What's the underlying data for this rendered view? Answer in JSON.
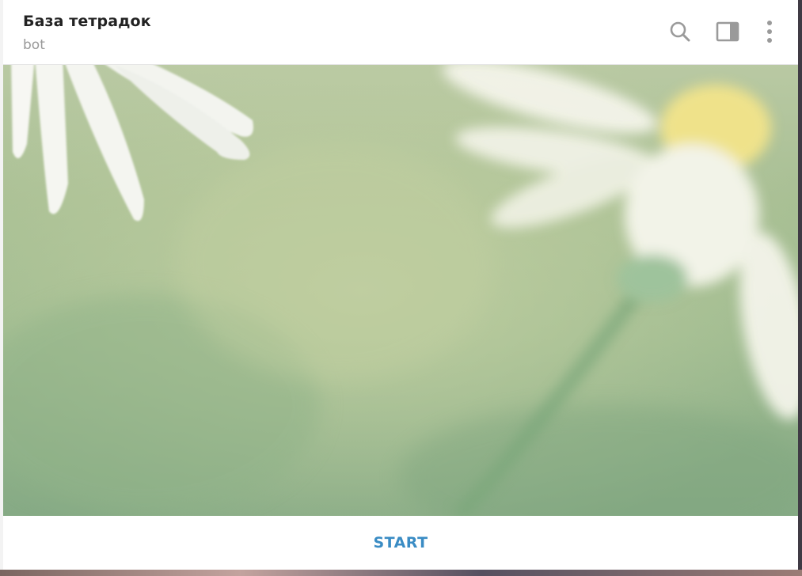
{
  "header": {
    "title": "База тетрадок",
    "subtitle": "bot",
    "icons": {
      "search": "search-icon",
      "side_panel": "side-panel-icon",
      "more": "more-vertical-icon"
    }
  },
  "chat": {
    "wallpaper": "daisy-flowers-wallpaper"
  },
  "bottom": {
    "start_label": "START"
  },
  "colors": {
    "accent": "#3a8cc4",
    "title": "#222222",
    "subtitle": "#999999",
    "icons": "#9a9a9a"
  }
}
